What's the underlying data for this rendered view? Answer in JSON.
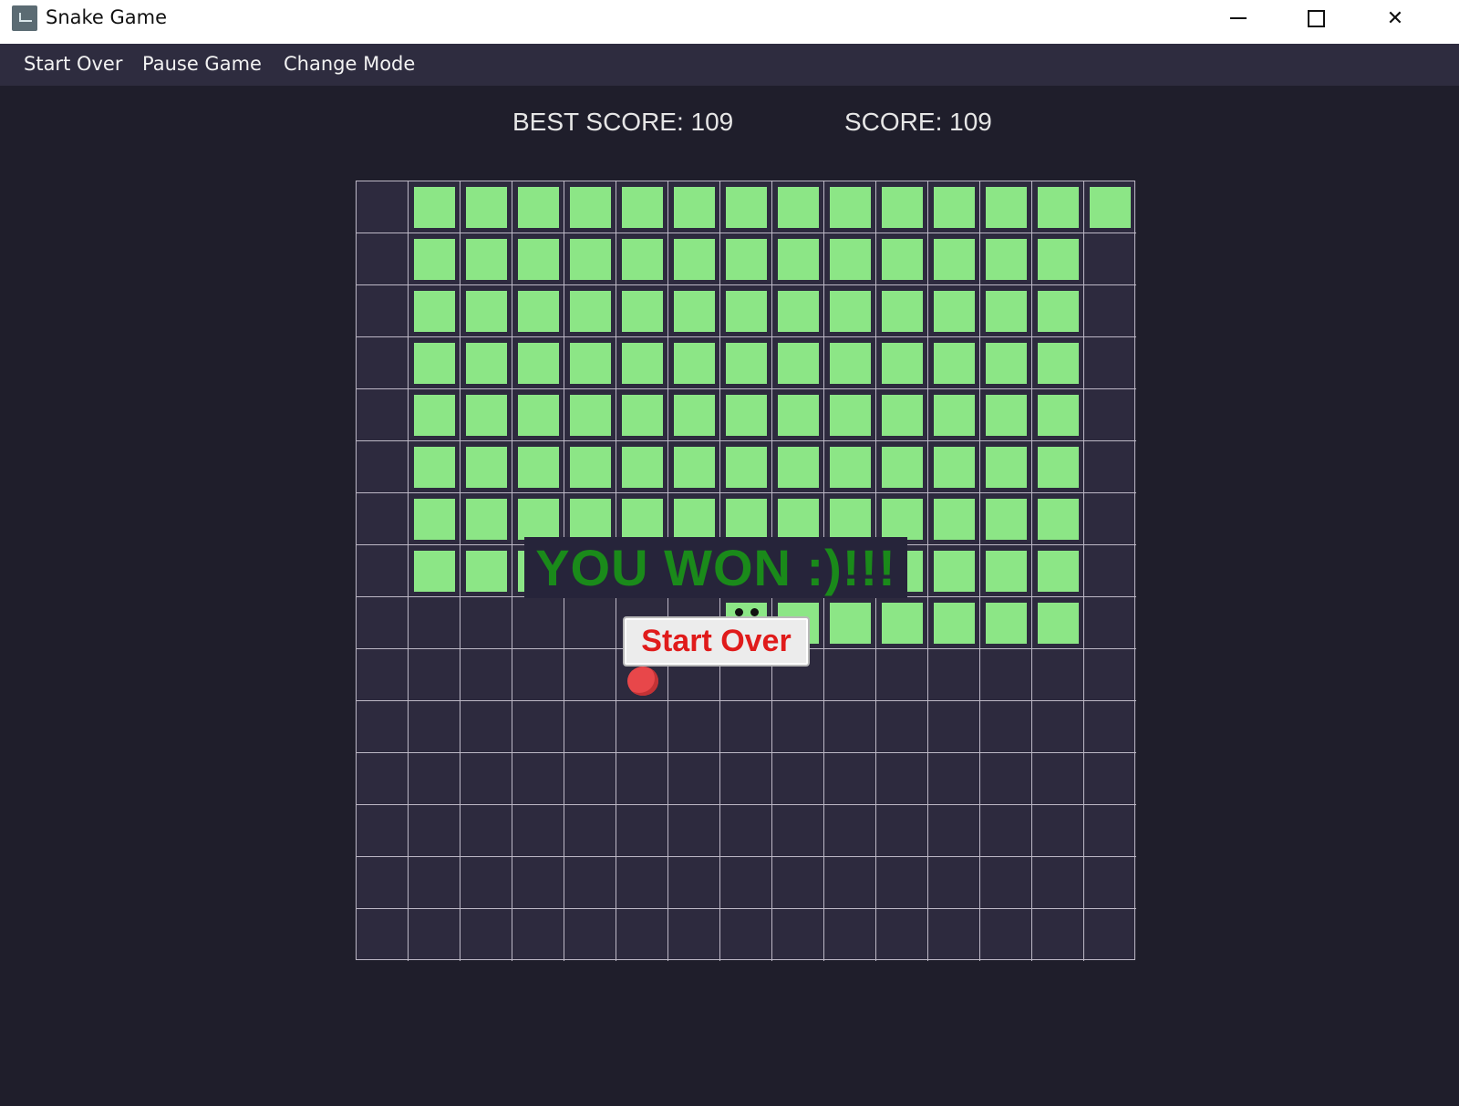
{
  "window": {
    "title": "Snake Game",
    "icon": "snake-app-icon",
    "controls": [
      "minimize-icon",
      "maximize-icon",
      "close-icon"
    ]
  },
  "menu": {
    "items": [
      {
        "label": "Start Over"
      },
      {
        "label": "Pause Game"
      },
      {
        "label": "Change Mode"
      }
    ]
  },
  "scoreboard": {
    "best_score_text": "BEST SCORE: 109",
    "score_text": "SCORE: 109"
  },
  "board": {
    "rows": 15,
    "cols": 15,
    "snake_color": "#8ce686",
    "apple_color": "#e8474a",
    "snake_body": [
      [
        0,
        1
      ],
      [
        0,
        2
      ],
      [
        0,
        3
      ],
      [
        0,
        4
      ],
      [
        0,
        5
      ],
      [
        0,
        6
      ],
      [
        0,
        7
      ],
      [
        0,
        8
      ],
      [
        0,
        9
      ],
      [
        0,
        10
      ],
      [
        0,
        11
      ],
      [
        0,
        12
      ],
      [
        0,
        13
      ],
      [
        0,
        14
      ],
      [
        1,
        1
      ],
      [
        1,
        2
      ],
      [
        1,
        3
      ],
      [
        1,
        4
      ],
      [
        1,
        5
      ],
      [
        1,
        6
      ],
      [
        1,
        7
      ],
      [
        1,
        8
      ],
      [
        1,
        9
      ],
      [
        1,
        10
      ],
      [
        1,
        11
      ],
      [
        1,
        12
      ],
      [
        1,
        13
      ],
      [
        2,
        1
      ],
      [
        2,
        2
      ],
      [
        2,
        3
      ],
      [
        2,
        4
      ],
      [
        2,
        5
      ],
      [
        2,
        6
      ],
      [
        2,
        7
      ],
      [
        2,
        8
      ],
      [
        2,
        9
      ],
      [
        2,
        10
      ],
      [
        2,
        11
      ],
      [
        2,
        12
      ],
      [
        2,
        13
      ],
      [
        3,
        1
      ],
      [
        3,
        2
      ],
      [
        3,
        3
      ],
      [
        3,
        4
      ],
      [
        3,
        5
      ],
      [
        3,
        6
      ],
      [
        3,
        7
      ],
      [
        3,
        8
      ],
      [
        3,
        9
      ],
      [
        3,
        10
      ],
      [
        3,
        11
      ],
      [
        3,
        12
      ],
      [
        3,
        13
      ],
      [
        4,
        1
      ],
      [
        4,
        2
      ],
      [
        4,
        3
      ],
      [
        4,
        4
      ],
      [
        4,
        5
      ],
      [
        4,
        6
      ],
      [
        4,
        7
      ],
      [
        4,
        8
      ],
      [
        4,
        9
      ],
      [
        4,
        10
      ],
      [
        4,
        11
      ],
      [
        4,
        12
      ],
      [
        4,
        13
      ],
      [
        5,
        1
      ],
      [
        5,
        2
      ],
      [
        5,
        3
      ],
      [
        5,
        4
      ],
      [
        5,
        5
      ],
      [
        5,
        6
      ],
      [
        5,
        7
      ],
      [
        5,
        8
      ],
      [
        5,
        9
      ],
      [
        5,
        10
      ],
      [
        5,
        11
      ],
      [
        5,
        12
      ],
      [
        5,
        13
      ],
      [
        6,
        1
      ],
      [
        6,
        2
      ],
      [
        6,
        3
      ],
      [
        6,
        4
      ],
      [
        6,
        5
      ],
      [
        6,
        6
      ],
      [
        6,
        7
      ],
      [
        6,
        8
      ],
      [
        6,
        9
      ],
      [
        6,
        10
      ],
      [
        6,
        11
      ],
      [
        6,
        12
      ],
      [
        6,
        13
      ],
      [
        7,
        1
      ],
      [
        7,
        2
      ],
      [
        7,
        3
      ],
      [
        7,
        4
      ],
      [
        7,
        5
      ],
      [
        7,
        6
      ],
      [
        7,
        7
      ],
      [
        7,
        8
      ],
      [
        7,
        9
      ],
      [
        7,
        10
      ],
      [
        7,
        11
      ],
      [
        7,
        12
      ],
      [
        7,
        13
      ],
      [
        8,
        8
      ],
      [
        8,
        9
      ],
      [
        8,
        10
      ],
      [
        8,
        11
      ],
      [
        8,
        12
      ],
      [
        8,
        13
      ]
    ],
    "snake_head": [
      8,
      7
    ],
    "apple": [
      9,
      5
    ]
  },
  "overlay": {
    "message": "YOU WON :)!!!",
    "button_label": "Start Over"
  }
}
